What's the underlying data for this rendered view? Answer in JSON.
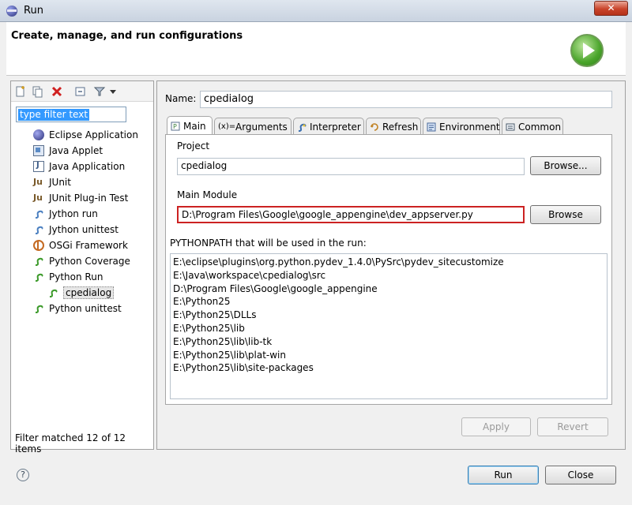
{
  "window": {
    "title": "Run",
    "close_glyph": "✕"
  },
  "banner": {
    "text": "Create, manage, and run configurations"
  },
  "left": {
    "filter_placeholder": "type filter text",
    "tree": [
      {
        "label": "Eclipse Application",
        "icon": "eclipse-icon"
      },
      {
        "label": "Java Applet",
        "icon": "applet-icon"
      },
      {
        "label": "Java Application",
        "icon": "java-app-icon"
      },
      {
        "label": "JUnit",
        "icon": "junit-icon"
      },
      {
        "label": "JUnit Plug-in Test",
        "icon": "junit-plugin-icon"
      },
      {
        "label": "Jython run",
        "icon": "jython-icon"
      },
      {
        "label": "Jython unittest",
        "icon": "jython-unittest-icon"
      },
      {
        "label": "OSGi Framework",
        "icon": "osgi-icon"
      },
      {
        "label": "Python Coverage",
        "icon": "python-coverage-icon"
      },
      {
        "label": "Python Run",
        "icon": "python-run-icon"
      },
      {
        "label": "cpedialog",
        "icon": "python-config-icon"
      },
      {
        "label": "Python unittest",
        "icon": "python-unittest-icon"
      }
    ],
    "filter_status": "Filter matched 12 of 12 items"
  },
  "right": {
    "name_label": "Name:",
    "name_value": "cpedialog",
    "tabs": [
      {
        "label": "Main",
        "icon": "main-tab-icon"
      },
      {
        "label": "Arguments",
        "icon": "arguments-icon"
      },
      {
        "label": "Interpreter",
        "icon": "python-icon"
      },
      {
        "label": "Refresh",
        "icon": "refresh-icon"
      },
      {
        "label": "Environment",
        "icon": "environment-icon"
      },
      {
        "label": "Common",
        "icon": "common-icon"
      }
    ],
    "project_label": "Project",
    "project_value": "cpedialog",
    "browse_project_label": "Browse...",
    "main_module_label": "Main Module",
    "main_module_value": "D:\\Program Files\\Google\\google_appengine\\dev_appserver.py",
    "browse_module_label": "Browse",
    "pythonpath_label": "PYTHONPATH that will be used in the run:",
    "pythonpath": [
      "E:\\eclipse\\plugins\\org.python.pydev_1.4.0\\PySrc\\pydev_sitecustomize",
      "E:\\Java\\workspace\\cpedialog\\src",
      "D:\\Program Files\\Google\\google_appengine",
      "E:\\Python25",
      "E:\\Python25\\DLLs",
      "E:\\Python25\\lib",
      "E:\\Python25\\lib\\lib-tk",
      "E:\\Python25\\lib\\plat-win",
      "E:\\Python25\\lib\\site-packages"
    ],
    "apply_label": "Apply",
    "revert_label": "Revert"
  },
  "footer": {
    "help_glyph": "?",
    "run_label": "Run",
    "close_label": "Close"
  }
}
